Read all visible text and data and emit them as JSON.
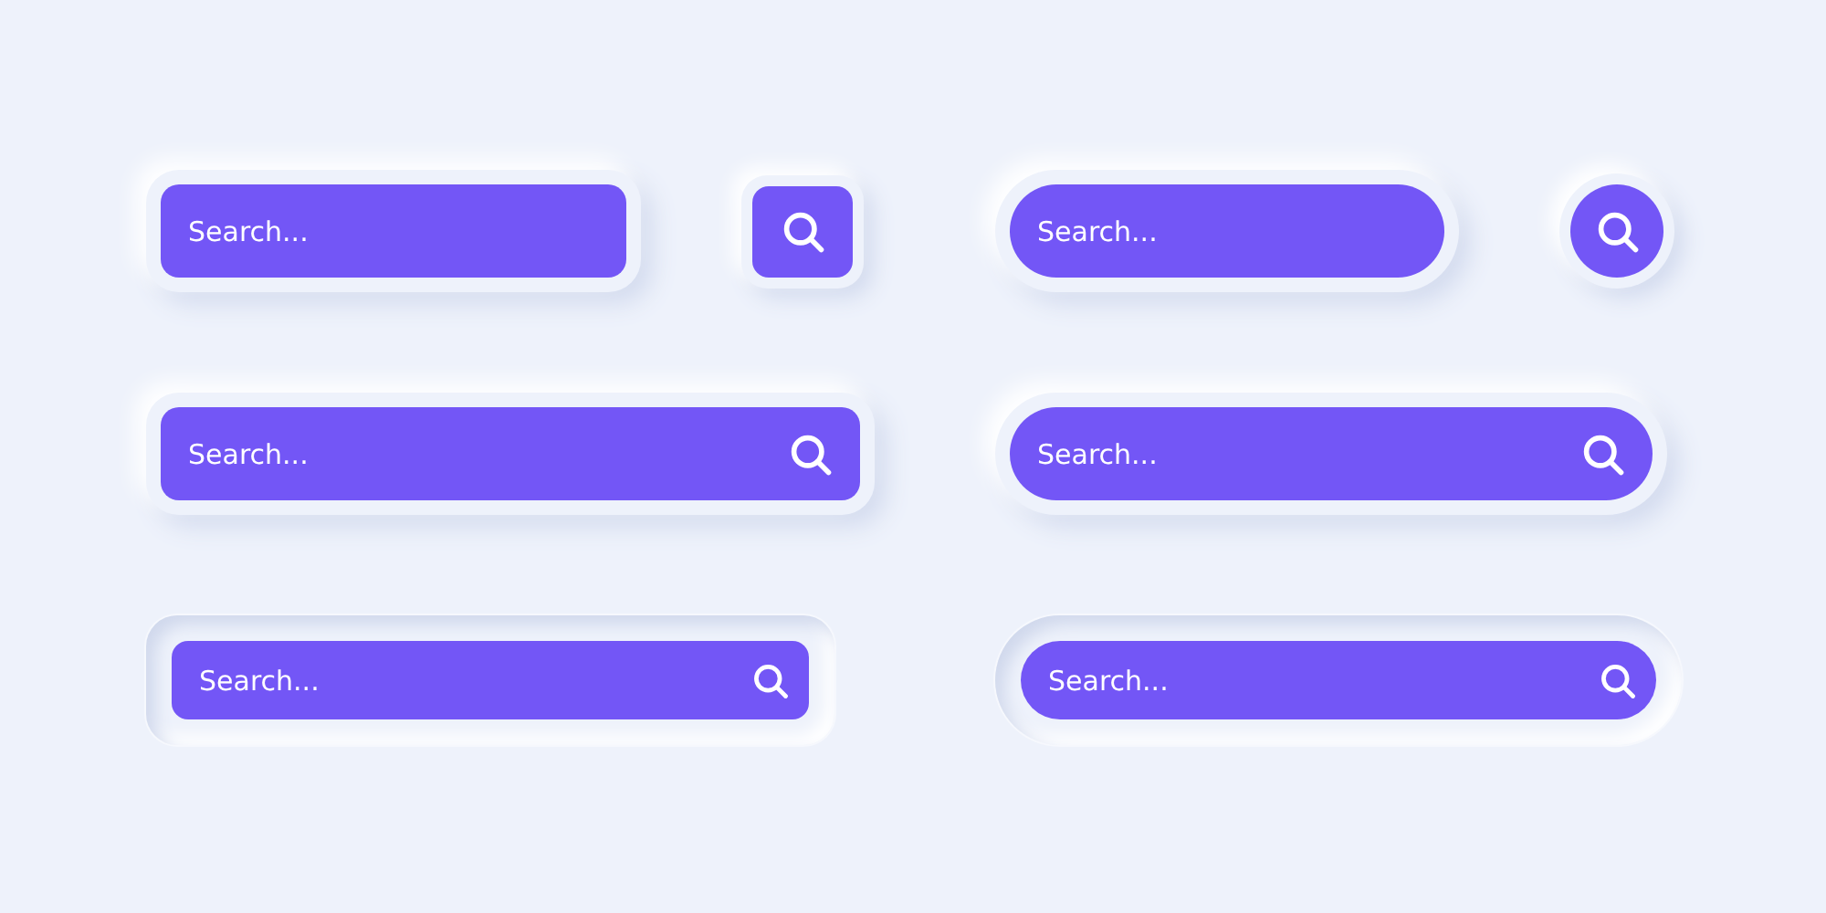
{
  "rows": [
    {
      "items": [
        {
          "kind": "field",
          "placeholder": "Search...",
          "icon": false
        },
        {
          "kind": "button"
        },
        {
          "kind": "field",
          "placeholder": "Search...",
          "icon": false
        },
        {
          "kind": "button"
        }
      ]
    },
    {
      "items": [
        {
          "kind": "field",
          "placeholder": "Search...",
          "icon": true
        },
        {
          "kind": "field",
          "placeholder": "Search...",
          "icon": true
        }
      ]
    },
    {
      "items": [
        {
          "kind": "field",
          "placeholder": "Search...",
          "icon": true
        },
        {
          "kind": "field",
          "placeholder": "Search...",
          "icon": true
        }
      ]
    }
  ]
}
